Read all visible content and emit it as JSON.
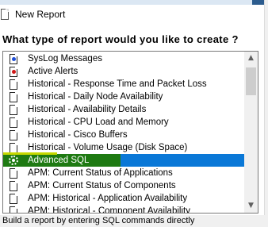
{
  "window": {
    "title": "New Report",
    "app_icon": "report-document-icon"
  },
  "question": "What type of report would you like to create ?",
  "report_types": {
    "selected_index": 8,
    "items": [
      {
        "label": "SysLog Messages",
        "icon": "syslog-document-icon",
        "dot_color": "#1f4fd8"
      },
      {
        "label": "Active Alerts",
        "icon": "alert-document-icon",
        "dot_color": "#d01818"
      },
      {
        "label": "Historical - Response Time and Packet Loss",
        "icon": "document-icon"
      },
      {
        "label": "Historical - Daily Node Availability",
        "icon": "document-icon"
      },
      {
        "label": "Historical - Availability Details",
        "icon": "document-icon"
      },
      {
        "label": "Historical - CPU Load and Memory",
        "icon": "document-icon"
      },
      {
        "label": "Historical - Cisco Buffers",
        "icon": "document-icon"
      },
      {
        "label": "Historical - Volume Usage (Disk Space)",
        "icon": "document-icon"
      },
      {
        "label": "Advanced SQL",
        "icon": "gear-icon"
      },
      {
        "label": "APM: Current Status of Applications",
        "icon": "document-icon"
      },
      {
        "label": "APM: Current Status of Components",
        "icon": "document-icon"
      },
      {
        "label": "APM: Historical - Application Availability",
        "icon": "document-icon"
      },
      {
        "label": "APM: Historical - Component Availability",
        "icon": "document-icon"
      }
    ]
  },
  "scrollbar": {
    "up_icon": "scroll-up-arrow-icon",
    "down_icon": "scroll-down-arrow-icon",
    "up_glyph": "▲",
    "down_glyph": "▼"
  },
  "status_bar": {
    "text": "Build a report by entering SQL commands directly"
  },
  "colors": {
    "selection": "#0a78d7",
    "highlight_green": "#1e7a12"
  }
}
